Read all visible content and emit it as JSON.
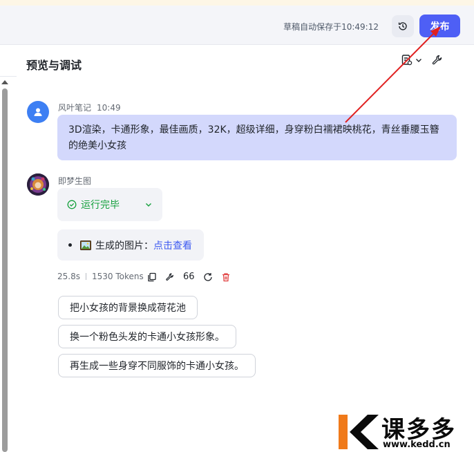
{
  "header": {
    "autosave_text": "草稿自动保存于10:49:12",
    "publish_label": "发布"
  },
  "panel": {
    "title": "预览与调试"
  },
  "conversation": {
    "user": {
      "name": "风叶笔记",
      "time": "10:49",
      "message": "3D渲染，卡通形象，最佳画质，32K，超级详细，身穿粉白襦裙映桃花，青丝垂腰玉簪的绝美小女孩"
    },
    "bot": {
      "name": "即梦生图",
      "status_label": "运行完毕",
      "image_prefix": "生成的图片：",
      "image_link": "点击查看",
      "stats": {
        "duration": "25.8s",
        "tokens": "1530 Tokens",
        "quote_count": "66"
      }
    },
    "suggestions": [
      "把小女孩的背景换成荷花池",
      "换一个粉色头发的卡通小女孩形象。",
      "再生成一些身穿不同服饰的卡通小女孩。"
    ]
  },
  "watermark": {
    "brand": "课多多",
    "url": "www.kedd.cn"
  },
  "colors": {
    "accent": "#4e5ff5",
    "user_bubble": "#d3d8fc",
    "success": "#14a03c",
    "link": "#3d5af1",
    "annotation_arrow": "#e02020",
    "watermark_orange": "#f07a1a"
  }
}
